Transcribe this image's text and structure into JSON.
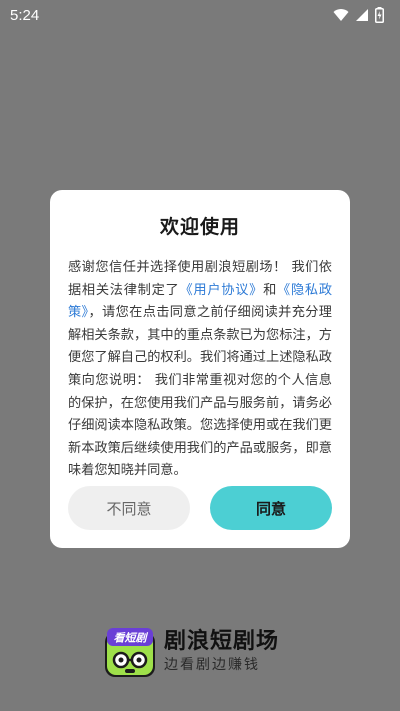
{
  "status_bar": {
    "time": "5:24",
    "icons": [
      "wifi-icon",
      "signal-icon",
      "battery-charging-icon"
    ]
  },
  "dialog": {
    "title": "欢迎使用",
    "body": {
      "part1": "感谢您信任并选择使用剧浪短剧场！ 我们依据相关法律制定了",
      "link_user_agreement": "《用户协议》",
      "part2": "和",
      "link_privacy_policy": "《隐私政策》",
      "part3": "，请您在点击同意之前仔细阅读并充分理解相关条款，其中的重点条款已为您标注，方便您了解自己的权利。我们将通过上述隐私政策向您说明： 我们非常重视对您的个人信息的保护，在您使用我们产品与服务前，请务必仔细阅读本隐私政策。您选择使用或在我们更新本政策后继续使用我们的产品或服务，即意味着您知晓并同意。"
    },
    "buttons": {
      "disagree": "不同意",
      "agree": "同意"
    }
  },
  "brand": {
    "logo_badge": "看短剧",
    "name": "剧浪短剧场",
    "slogan": "边看剧边赚钱"
  },
  "colors": {
    "overlay": "#7a7a7a",
    "link": "#2e7bd6",
    "agree_button": "#4ccfd3",
    "disagree_button": "#efefef"
  }
}
